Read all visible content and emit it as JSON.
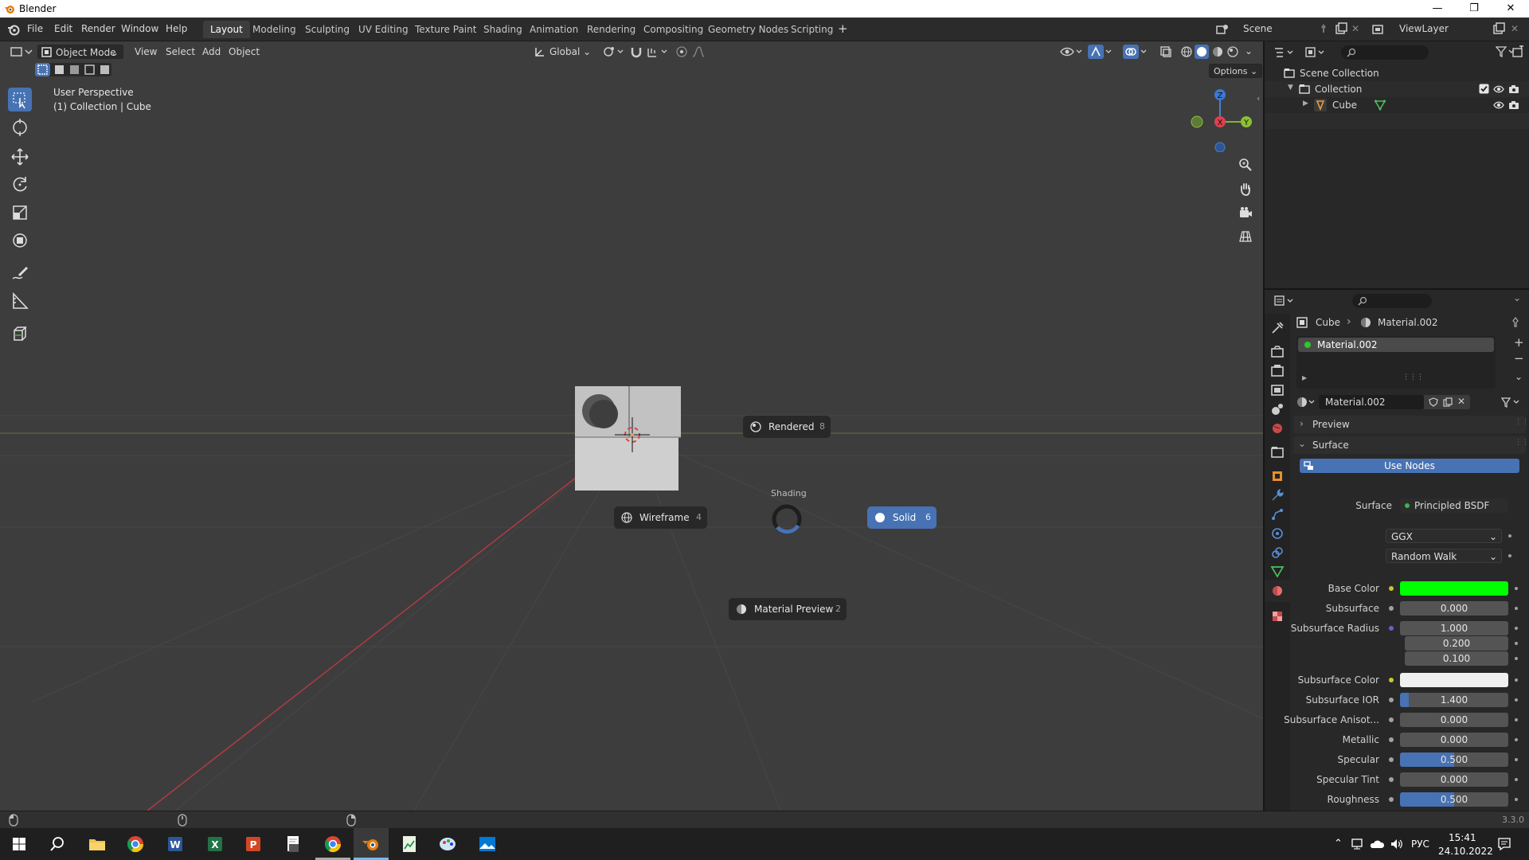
{
  "window": {
    "title": "Blender"
  },
  "menu": {
    "items": [
      "File",
      "Edit",
      "Render",
      "Window",
      "Help"
    ]
  },
  "workspaces": {
    "tabs": [
      "Layout",
      "Modeling",
      "Sculpting",
      "UV Editing",
      "Texture Paint",
      "Shading",
      "Animation",
      "Rendering",
      "Compositing",
      "Geometry Nodes",
      "Scripting"
    ],
    "active": "Layout",
    "add": "+"
  },
  "scene": {
    "name": "Scene"
  },
  "viewlayer": {
    "name": "ViewLayer"
  },
  "viewport": {
    "mode": "Object Mode",
    "menus": [
      "View",
      "Select",
      "Add",
      "Object"
    ],
    "orientation": "Global",
    "options": "Options",
    "overlay_title": "User Perspective",
    "overlay_sub": "(1) Collection | Cube",
    "gizmo": {
      "z": "Z",
      "y": "Y",
      "x": "X"
    }
  },
  "pie_menu": {
    "title": "Shading",
    "items": {
      "rendered": {
        "label": "Rendered",
        "key": "8"
      },
      "wireframe": {
        "label": "Wireframe",
        "key": "4"
      },
      "solid": {
        "label": "Solid",
        "key": "6"
      },
      "material_preview": {
        "label": "Material Preview",
        "key": "2"
      }
    },
    "selected": "Solid"
  },
  "outliner": {
    "root": "Scene Collection",
    "collection": "Collection",
    "object": "Cube"
  },
  "properties": {
    "breadcrumb": {
      "object": "Cube",
      "material": "Material.002"
    },
    "slot": "Material.002",
    "material_name": "Material.002",
    "preview_panel": "Preview",
    "surface_panel": "Surface",
    "use_nodes": "Use Nodes",
    "surface_label": "Surface",
    "surface_shader": "Principled BSDF",
    "distribution": "GGX",
    "subsurface_method": "Random Walk",
    "fields": [
      {
        "label": "Base Color",
        "type": "color",
        "color": "#00ff00",
        "socket": "#c7c729"
      },
      {
        "label": "Subsurface",
        "value": "0.000",
        "fill": 0,
        "socket": "#a1a1a1"
      },
      {
        "label": "Subsurface Radius",
        "value": "1.000",
        "fill": 0,
        "socket": "#6363c7"
      },
      {
        "label": "",
        "value": "0.200",
        "fill": 0,
        "socket": ""
      },
      {
        "label": "",
        "value": "0.100",
        "fill": 0,
        "socket": ""
      },
      {
        "label": "Subsurface Color",
        "type": "color",
        "color": "#f0f0f0",
        "socket": "#c7c729"
      },
      {
        "label": "Subsurface IOR",
        "value": "1.400",
        "fill": 0.08,
        "socket": "#a1a1a1"
      },
      {
        "label": "Subsurface Anisot...",
        "value": "0.000",
        "fill": 0,
        "socket": "#a1a1a1"
      },
      {
        "label": "Metallic",
        "value": "0.000",
        "fill": 0,
        "socket": "#a1a1a1"
      },
      {
        "label": "Specular",
        "value": "0.500",
        "fill": 0.5,
        "socket": "#a1a1a1"
      },
      {
        "label": "Specular Tint",
        "value": "0.000",
        "fill": 0,
        "socket": "#a1a1a1"
      },
      {
        "label": "Roughness",
        "value": "0.500",
        "fill": 0.5,
        "socket": "#a1a1a1"
      }
    ]
  },
  "statusbar": {
    "version": "3.3.0"
  },
  "taskbar": {
    "lang": "РУС",
    "time": "15:41",
    "date": "24.10.2022"
  },
  "colors": {
    "accent": "#4772b3",
    "viewport_bg": "#3d3d3d",
    "panel_bg": "#282828"
  }
}
